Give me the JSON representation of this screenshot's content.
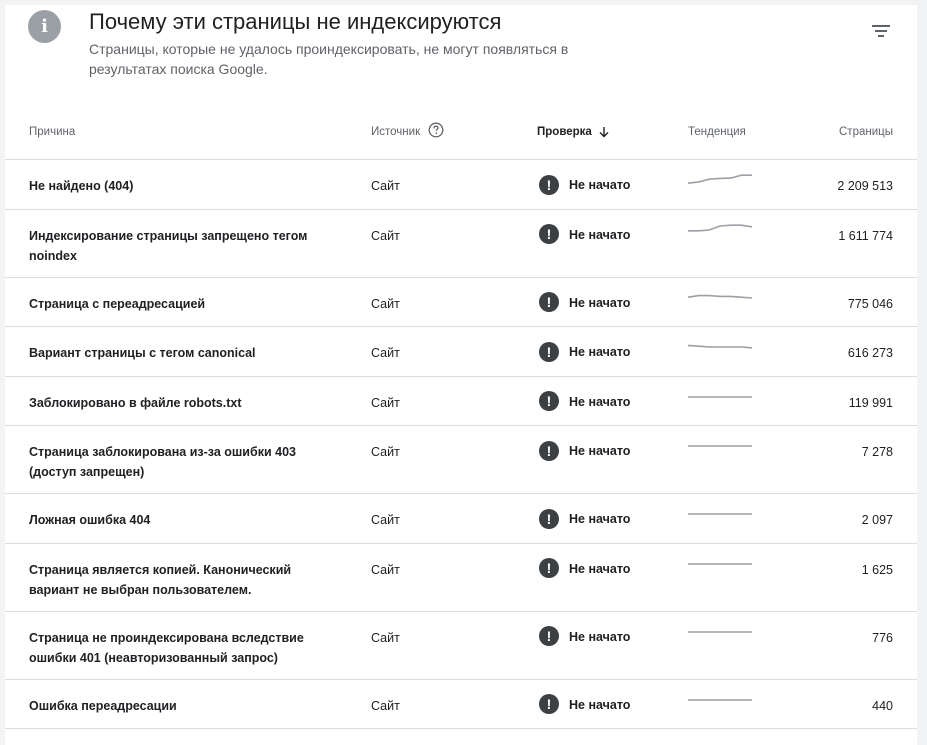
{
  "header": {
    "title": "Почему эти страницы не индексируются",
    "subtitle": "Страницы, которые не удалось проиндексировать, не могут появляться в результатах поиска Google.",
    "info_icon": "info-icon",
    "filter_icon": "filter-icon"
  },
  "columns": {
    "reason": "Причина",
    "source": "Источник",
    "check": "Проверка",
    "trend": "Тенденция",
    "pages": "Страницы"
  },
  "colors": {
    "trend_line": "#9aa0a6",
    "warn_icon": "#3c4043",
    "divider": "#dadce0"
  },
  "rows": [
    {
      "reason": "Не найдено (404)",
      "source": "Сайт",
      "status": "Не начато",
      "pages": "2 209 513",
      "trend": [
        0.3,
        0.38,
        0.55,
        0.6,
        0.62,
        0.8,
        0.8
      ]
    },
    {
      "reason": "Индексирование страницы запрещено тегом noindex",
      "source": "Сайт",
      "status": "Не начато",
      "pages": "1 611 774",
      "trend": [
        0.45,
        0.45,
        0.5,
        0.75,
        0.8,
        0.8,
        0.7
      ]
    },
    {
      "reason": "Страница с переадресацией",
      "source": "Сайт",
      "status": "Не начато",
      "pages": "775 046",
      "trend": [
        0.55,
        0.65,
        0.65,
        0.6,
        0.6,
        0.55,
        0.5
      ]
    },
    {
      "reason": "Вариант страницы с тегом canonical",
      "source": "Сайт",
      "status": "Не начато",
      "pages": "616 273",
      "trend": [
        0.6,
        0.55,
        0.5,
        0.5,
        0.5,
        0.5,
        0.45
      ]
    },
    {
      "reason": "Заблокировано в файле robots.txt",
      "source": "Сайт",
      "status": "Не начато",
      "pages": "119 991",
      "trend": [
        0.5,
        0.5,
        0.5,
        0.5,
        0.5,
        0.5,
        0.5
      ]
    },
    {
      "reason": "Страница заблокирована из-за ошибки 403 (доступ запрещен)",
      "source": "Сайт",
      "status": "Не начато",
      "pages": "7 278",
      "trend": [
        0.5,
        0.5,
        0.5,
        0.5,
        0.5,
        0.5,
        0.5
      ]
    },
    {
      "reason": "Ложная ошибка 404",
      "source": "Сайт",
      "status": "Не начато",
      "pages": "2 097",
      "trend": [
        0.5,
        0.5,
        0.5,
        0.5,
        0.5,
        0.5,
        0.5
      ]
    },
    {
      "reason": "Страница является копией. Канонический вариант не выбран пользователем.",
      "source": "Сайт",
      "status": "Не начато",
      "pages": "1 625",
      "trend": [
        0.5,
        0.5,
        0.5,
        0.5,
        0.5,
        0.5,
        0.5
      ]
    },
    {
      "reason": "Страница не проиндексирована вследствие ошибки 401 (неавторизованный запрос)",
      "source": "Сайт",
      "status": "Не начато",
      "pages": "776",
      "trend": [
        0.5,
        0.5,
        0.5,
        0.5,
        0.5,
        0.5,
        0.5
      ]
    },
    {
      "reason": "Ошибка переадресации",
      "source": "Сайт",
      "status": "Не начато",
      "pages": "440",
      "trend": [
        0.5,
        0.5,
        0.5,
        0.5,
        0.5,
        0.5,
        0.5
      ]
    }
  ]
}
